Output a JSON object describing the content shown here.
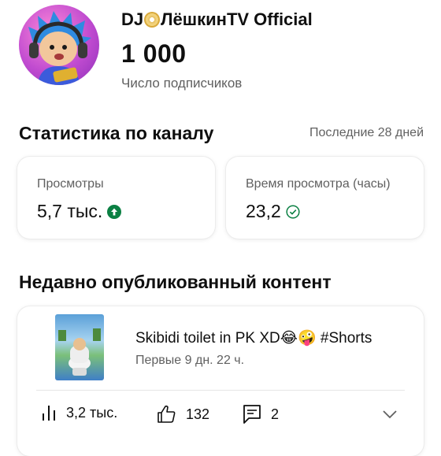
{
  "channel": {
    "name_part1": "DJ",
    "name_part2": "ЛёшкинTV Official",
    "disc_icon": "cd-disc-icon",
    "subscriber_count": "1 000",
    "subscriber_label": "Число подписчиков"
  },
  "stats": {
    "title": "Статистика по каналу",
    "period": "Последние 28 дней",
    "views": {
      "label": "Просмотры",
      "value": "5,7 тыс.",
      "icon": "arrow-up-circle-icon"
    },
    "watch_time": {
      "label": "Время просмотра (часы)",
      "value": "23,2",
      "icon": "check-circle-icon"
    }
  },
  "recent": {
    "title": "Недавно опубликованный контент",
    "video": {
      "title": "Skibidi toilet in PK XD😂🤪 #Shorts",
      "age": "Первые 9 дн. 22 ч.",
      "views": "3,2 тыс.",
      "likes": "132",
      "comments": "2"
    }
  },
  "colors": {
    "accent_green": "#0b8043",
    "text_primary": "#0f0f0f",
    "text_secondary": "#606060"
  }
}
